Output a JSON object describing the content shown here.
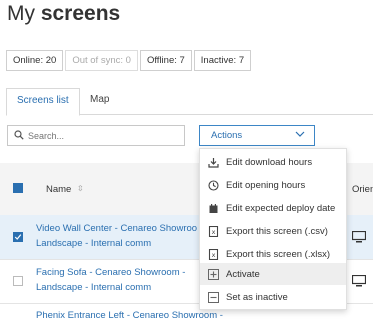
{
  "page": {
    "title_light": "My ",
    "title_bold": "screens"
  },
  "status_filters": [
    {
      "label": "Online: 20"
    },
    {
      "label": "Out of sync: 0"
    },
    {
      "label": "Offline: 7"
    },
    {
      "label": "Inactive: 7"
    }
  ],
  "tabs": [
    {
      "label": "Screens list",
      "active": true
    },
    {
      "label": "Map",
      "active": false
    }
  ],
  "search": {
    "placeholder": "Search..."
  },
  "actions": {
    "label": "Actions"
  },
  "table": {
    "headers": {
      "name": "Name",
      "orientation": "Orien"
    },
    "rows": [
      {
        "line1": "Video Wall Center - Cenareo Showroo",
        "line2": "Landscape - Internal comm",
        "selected": true
      },
      {
        "line1": "Facing Sofa - Cenareo Showroom -",
        "line2": "Landscape - Internal comm",
        "selected": false
      },
      {
        "line1": "Phenix Entrance Left - Cenareo Showroom -",
        "line2": "",
        "selected": false
      }
    ]
  },
  "actions_menu": [
    {
      "label": "Edit download hours",
      "icon": "download-icon"
    },
    {
      "label": "Edit opening hours",
      "icon": "clock-icon"
    },
    {
      "label": "Edit expected deploy date",
      "icon": "calendar-icon"
    },
    {
      "label": "Export this screen (.csv)",
      "icon": "csv-file-icon"
    },
    {
      "label": "Export this screen (.xlsx)",
      "icon": "xlsx-file-icon"
    },
    {
      "label": "Activate",
      "icon": "plus-square-icon",
      "highlighted": true
    },
    {
      "label": "Set as inactive",
      "icon": "minus-square-icon"
    }
  ],
  "colors": {
    "accent": "#2a6fb0",
    "row_selected": "#e6f0f9"
  }
}
